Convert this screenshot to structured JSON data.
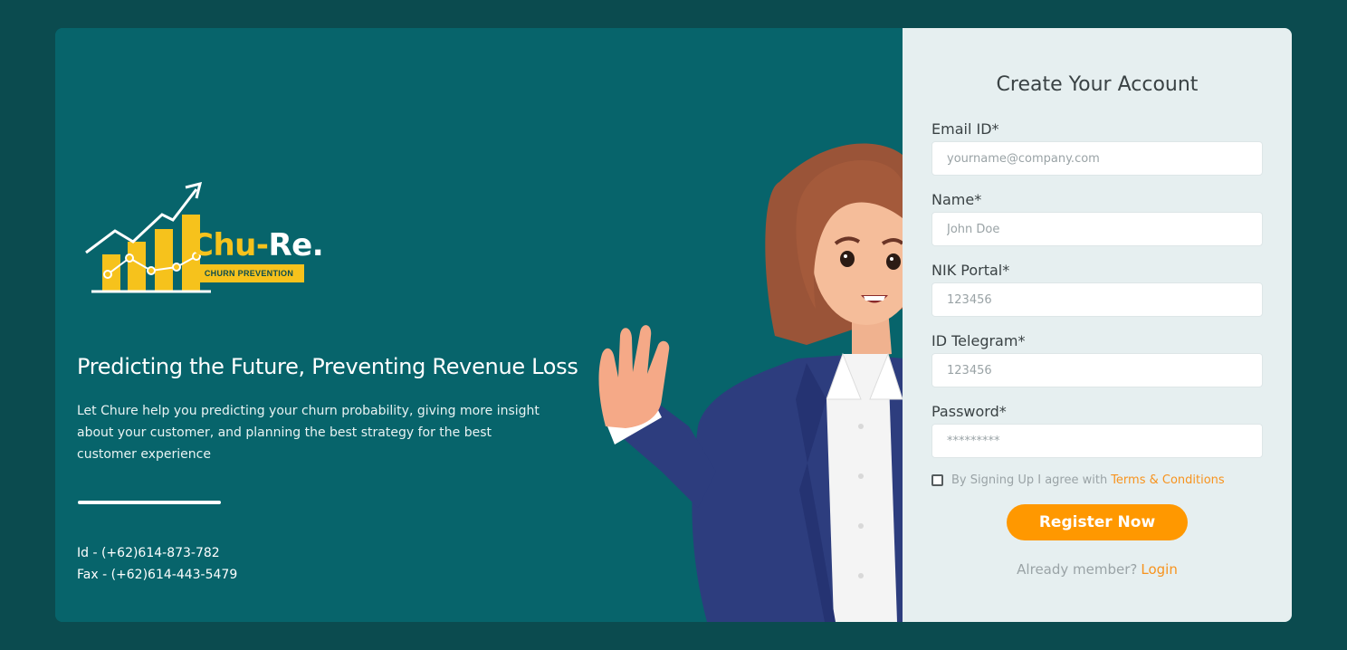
{
  "brand": {
    "name_main": "Chu-",
    "name_accent": "Re.",
    "tagline": "CHURN PREVENTION"
  },
  "hero": {
    "headline": "Predicting the Future, Preventing Revenue Loss",
    "description": "Let Chure help you predicting your churn probability, giving more insight about your customer, and planning the best strategy for the best customer experience"
  },
  "contact": {
    "id_line": "Id - (+62)614-873-782",
    "fax_line": "Fax - (+62)614-443-5479"
  },
  "form": {
    "title": "Create Your Account",
    "fields": [
      {
        "label": "Email ID*",
        "placeholder": "yourname@company.com"
      },
      {
        "label": "Name*",
        "placeholder": "John Doe"
      },
      {
        "label": "NIK Portal*",
        "placeholder": "123456"
      },
      {
        "label": "ID Telegram*",
        "placeholder": "123456"
      },
      {
        "label": "Password*",
        "placeholder": "*********"
      }
    ],
    "agree_text": "By Signing Up I agree with",
    "terms_link": "Terms & Conditions",
    "register_label": "Register Now",
    "already_text": "Already member?",
    "login_link": "Login"
  },
  "colors": {
    "page_bg": "#0b4b4f",
    "panel_teal": "#07646b",
    "form_bg": "#e6eff0",
    "accent_orange": "#ff9800",
    "logo_yellow": "#f6c21c"
  }
}
